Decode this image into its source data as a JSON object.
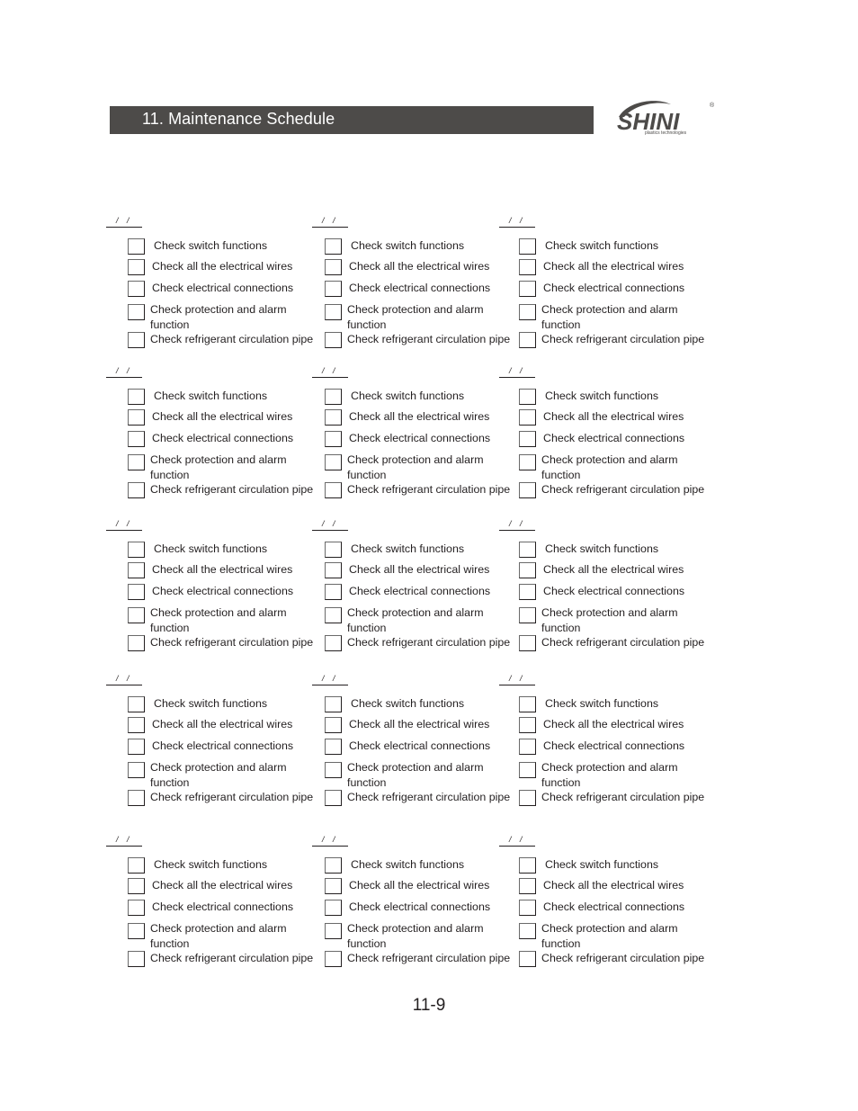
{
  "header": {
    "title": "11. Maintenance Schedule",
    "logo_text": "SHINI",
    "logo_tagline": "plastics technologies",
    "logo_mark": "®"
  },
  "date_blank": {
    "separator_1": "/",
    "separator_2": "/"
  },
  "checklist_items": [
    {
      "label": "Check switch functions"
    },
    {
      "label": "Check all the electrical wires"
    },
    {
      "label": "Check electrical connections"
    },
    {
      "label": "Check protection and alarm",
      "label_line2": "function"
    },
    {
      "label": "Check refrigerant circulation pipe"
    }
  ],
  "grid": {
    "row_groups": 5,
    "columns": 3
  },
  "checked_state": "all unchecked",
  "page_number": "11-9"
}
